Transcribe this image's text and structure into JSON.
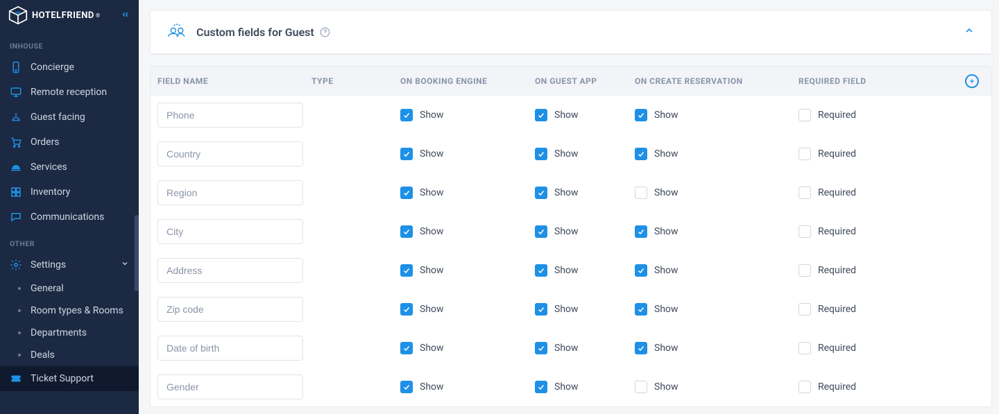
{
  "brand": {
    "name": "HOTELFRIEND"
  },
  "sidebar": {
    "sections": [
      {
        "label": "INHOUSE",
        "items": [
          {
            "id": "concierge",
            "label": "Concierge"
          },
          {
            "id": "remote-reception",
            "label": "Remote reception"
          },
          {
            "id": "guest-facing",
            "label": "Guest facing"
          },
          {
            "id": "orders",
            "label": "Orders"
          },
          {
            "id": "services",
            "label": "Services"
          },
          {
            "id": "inventory",
            "label": "Inventory"
          },
          {
            "id": "communications",
            "label": "Communications"
          }
        ]
      },
      {
        "label": "OTHER",
        "items": [
          {
            "id": "settings",
            "label": "Settings",
            "expanded": true,
            "children": [
              {
                "id": "general",
                "label": "General"
              },
              {
                "id": "room-types",
                "label": "Room types & Rooms"
              },
              {
                "id": "departments",
                "label": "Departments"
              },
              {
                "id": "deals",
                "label": "Deals"
              }
            ]
          },
          {
            "id": "ticket-support",
            "label": "Ticket Support",
            "active": true
          }
        ]
      }
    ]
  },
  "panel": {
    "title": "Custom fields for Guest"
  },
  "table": {
    "headers": {
      "field_name": "FIELD NAME",
      "type": "TYPE",
      "on_booking_engine": "ON BOOKING ENGINE",
      "on_guest_app": "ON GUEST APP",
      "on_create_reservation": "ON CREATE RESERVATION",
      "required_field": "REQUIRED FIELD"
    },
    "labels": {
      "show": "Show",
      "required": "Required"
    },
    "rows": [
      {
        "name": "Phone",
        "be": true,
        "app": true,
        "create": true,
        "required": false
      },
      {
        "name": "Country",
        "be": true,
        "app": true,
        "create": true,
        "required": false
      },
      {
        "name": "Region",
        "be": true,
        "app": true,
        "create": false,
        "required": false
      },
      {
        "name": "City",
        "be": true,
        "app": true,
        "create": true,
        "required": false
      },
      {
        "name": "Address",
        "be": true,
        "app": true,
        "create": true,
        "required": false
      },
      {
        "name": "Zip code",
        "be": true,
        "app": true,
        "create": true,
        "required": false
      },
      {
        "name": "Date of birth",
        "be": true,
        "app": true,
        "create": true,
        "required": false
      },
      {
        "name": "Gender",
        "be": true,
        "app": true,
        "create": false,
        "required": false
      }
    ]
  }
}
